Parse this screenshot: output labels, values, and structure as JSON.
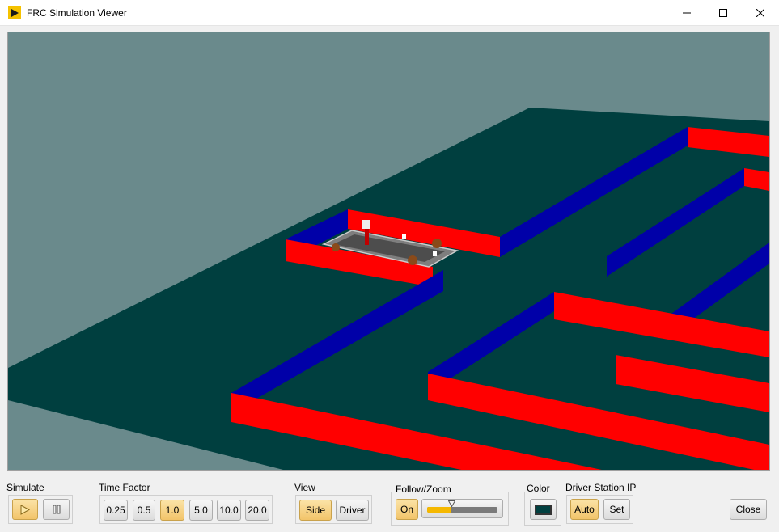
{
  "window": {
    "title": "FRC Simulation Viewer"
  },
  "colors": {
    "floor": "#003f3f",
    "sky": "#6a8a8c",
    "wall_red": "#ff0000",
    "wall_blue": "#0000a8",
    "button_active": "#f2c46a"
  },
  "simulate": {
    "label": "Simulate",
    "play_icon": "play-icon",
    "pause_icon": "pause-icon"
  },
  "time_factor": {
    "label": "Time Factor",
    "options": [
      "0.25",
      "0.5",
      "1.0",
      "5.0",
      "10.0",
      "20.0"
    ],
    "selected": "1.0"
  },
  "view": {
    "label": "View",
    "options": [
      "Side",
      "Driver"
    ],
    "selected": "Side"
  },
  "follow_zoom": {
    "label": "Follow/Zoom",
    "toggle_label": "On",
    "zoom_level": 0.35
  },
  "color": {
    "label": "Color"
  },
  "driver_station": {
    "label": "Driver Station IP",
    "auto_label": "Auto",
    "set_label": "Set"
  },
  "close_label": "Close"
}
